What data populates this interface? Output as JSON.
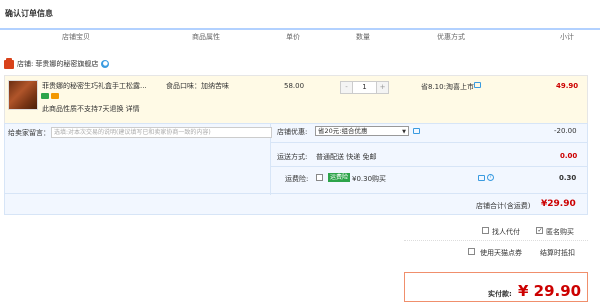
{
  "page": {
    "title": "确认订单信息"
  },
  "headers": {
    "store_item": "店铺宝贝",
    "attrs": "商品属性",
    "price": "单价",
    "qty": "数量",
    "promo": "优惠方式",
    "subtotal": "小计"
  },
  "store": {
    "label": "店铺:",
    "name": "菲贵娜的秘密旗舰店"
  },
  "item": {
    "title": "菲贵娜的秘密生巧礼盒手工松露...",
    "attr": "食品口味：加纳苦味",
    "notice": "此商品性质不支持7天退换 详情",
    "price": "58.00",
    "qty": "1",
    "minus": "-",
    "plus": "+",
    "promo": "省8.10:淘喜上市",
    "subtotal": "49.90"
  },
  "options": {
    "message_label": "给卖家留言：",
    "message_placeholder": "选填:对本次交易的说明(建议填写已和卖家协商一致的内容)",
    "store_discount_label": "店铺优惠:",
    "store_discount_value": "省20元:组合优惠",
    "store_discount_amount": "-20.00",
    "shipping_label": "运送方式:",
    "shipping_value": "普通配送 快递 免邮",
    "shipping_amount": "0.00",
    "insurance_label": "运费险:",
    "insurance_tag": "运费险",
    "insurance_value": "¥0.30购买",
    "insurance_amount": "0.30",
    "total_label": "店铺合计(含运费)",
    "total_value": "¥29.90"
  },
  "extras": {
    "proxy_pay": "找人代付",
    "anonymous": "匿名购买",
    "tmall_coupon": "使用天猫点券",
    "settlement": "结算时抵扣"
  },
  "payment": {
    "label": "实付款:",
    "amount": "¥ 29.90"
  },
  "colors": {
    "accent_red": "#cc0000",
    "header_border": "#b2d1ff",
    "promo_blue": "#3a9be0"
  }
}
